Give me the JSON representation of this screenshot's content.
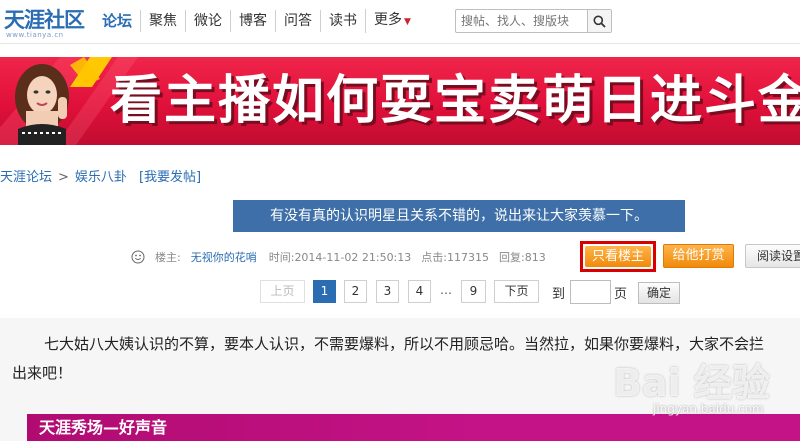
{
  "logo": {
    "main": "天涯社区",
    "sub": "www.tianya.cn"
  },
  "nav": {
    "items": [
      "论坛",
      "聚焦",
      "微论",
      "博客",
      "问答",
      "读书",
      "更多"
    ]
  },
  "search": {
    "placeholder": "搜帖、找人、搜版块"
  },
  "banner": {
    "text": "看主播如何耍宝卖萌日进斗金"
  },
  "breadcrumb": {
    "home": "天涯论坛",
    "separator": ">",
    "board": "娱乐八卦",
    "post_link": "[我要发帖]"
  },
  "post": {
    "title": "有没有真的认识明星且关系不错的，说出来让大家羡慕一下。",
    "author_label": "楼主:",
    "author": "无视你的花哨",
    "time_label": "时间:",
    "time": "2014-11-02 21:50:13",
    "clicks_label": "点击:",
    "clicks": "117315",
    "replies_label": "回复:",
    "replies": "813"
  },
  "buttons": {
    "landlord_only": "只看楼主",
    "reward": "给他打赏",
    "read_settings": "阅读设置"
  },
  "pager": {
    "prev": "上页",
    "pages": [
      "1",
      "2",
      "3",
      "4"
    ],
    "dots": "…",
    "last": "9",
    "next": "下页",
    "goto_label": "到",
    "page_suffix": "页",
    "confirm": "确定",
    "current": "1"
  },
  "content": {
    "line1": "七大姑八大姨认识的不算，要本人认识，不需要爆料，所以不用顾忌哈。当然拉，如果你要爆料，大家不会拦",
    "line2": "出来吧！"
  },
  "promo": {
    "text": "天涯秀场—好声音"
  },
  "watermark": {
    "text": "Bai 经验",
    "sub": "jingyan.baidu.com"
  },
  "colors": {
    "brand_blue": "#2a6db3",
    "title_bg": "#3f6fa8",
    "banner_red": "#e0103a",
    "orange_button": "#f08a0a",
    "promo_purple": "#c41386"
  }
}
